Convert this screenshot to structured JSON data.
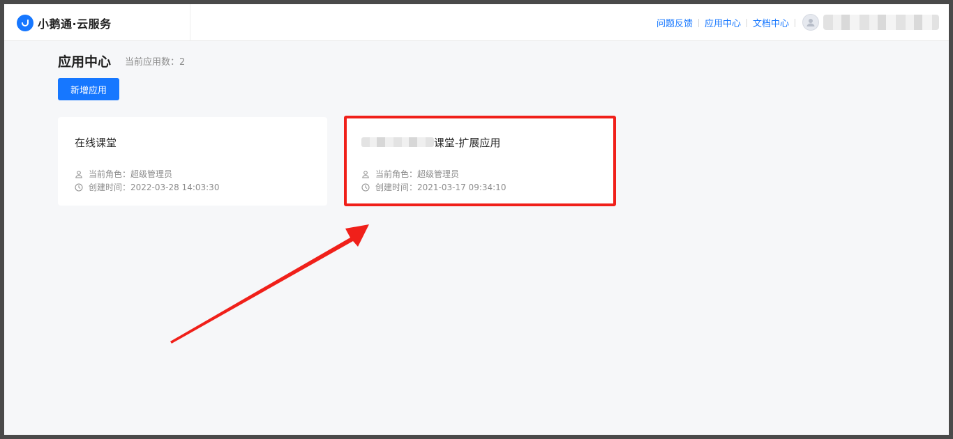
{
  "header": {
    "brand_name": "小鹅通·云服务",
    "nav": [
      {
        "label": "问题反馈"
      },
      {
        "label": "应用中心"
      },
      {
        "label": "文档中心"
      }
    ]
  },
  "main": {
    "title": "应用中心",
    "count_label": "当前应用数：2",
    "add_button_label": "新增应用",
    "apps": [
      {
        "title": "在线课堂",
        "role": "当前角色：超级管理员",
        "created": "创建时间：2022-03-28 14:03:30"
      },
      {
        "title_suffix": "课堂-扩展应用",
        "role": "当前角色：超级管理员",
        "created": "创建时间：2021-03-17 09:34:10"
      }
    ]
  },
  "colors": {
    "accent": "#1677ff",
    "highlight": "#f0201a",
    "background": "#f6f7f9"
  },
  "icons": [
    "brand-logo-icon",
    "avatar-icon",
    "user-icon",
    "clock-icon",
    "arrow-annotation"
  ]
}
